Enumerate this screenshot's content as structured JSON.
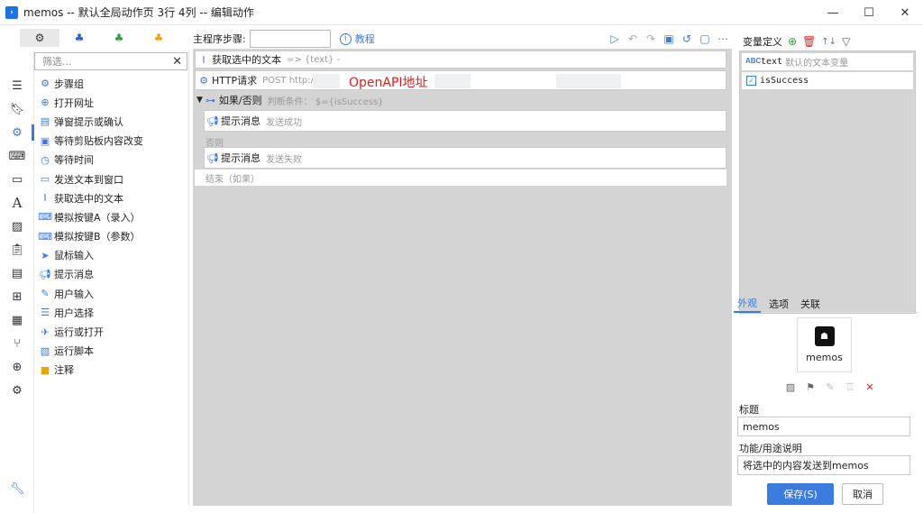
{
  "window": {
    "title": "memos -- 默认全局动作页 3行 4列 -- 编辑动作",
    "minimize": "—",
    "maximize": "☐",
    "close": "✕"
  },
  "left_tabs": [
    {
      "icon": "gears-icon"
    },
    {
      "icon": "cube-blue-icon"
    },
    {
      "icon": "cube-green-icon"
    },
    {
      "icon": "cube-orange-icon"
    }
  ],
  "filter": {
    "placeholder": "筛选...",
    "clear": "✕"
  },
  "actions": [
    {
      "label": "步骤组"
    },
    {
      "label": "打开网址"
    },
    {
      "label": "弹窗提示或确认"
    },
    {
      "label": "等待剪贴板内容改变"
    },
    {
      "label": "等待时间"
    },
    {
      "label": "发送文本到窗口"
    },
    {
      "label": "获取选中的文本"
    },
    {
      "label": "模拟按键A（录入）"
    },
    {
      "label": "模拟按键B（参数）"
    },
    {
      "label": "鼠标输入"
    },
    {
      "label": "提示消息"
    },
    {
      "label": "用户输入"
    },
    {
      "label": "用户选择"
    },
    {
      "label": "运行或打开"
    },
    {
      "label": "运行脚本"
    },
    {
      "label": "注释"
    }
  ],
  "topbar": {
    "step_label": "主程序步骤:",
    "help_label": "教程"
  },
  "steps": {
    "get_text": {
      "name": "获取选中的文本",
      "sub": "=> {text} -"
    },
    "http": {
      "name": "HTTP请求",
      "sub": "POST http://",
      "overlay": "OpenAPI地址"
    },
    "if": {
      "name": "如果/否则",
      "sub": "判断条件： $={isSuccess}"
    },
    "msg_ok": {
      "name": "提示消息",
      "sub": "发送成功"
    },
    "else": "否则",
    "msg_fail": {
      "name": "提示消息",
      "sub": "发送失败"
    },
    "end": "结束（如果）"
  },
  "vars": {
    "title": "变量定义",
    "items": [
      {
        "name": "text",
        "desc": "默认的文本变量",
        "type_icon": "ABC"
      },
      {
        "name": "isSuccess",
        "desc": "",
        "type_icon": "✓"
      }
    ]
  },
  "right_tabs": [
    "外观",
    "选项",
    "关联"
  ],
  "appearance": {
    "icon_name": "memos",
    "title_label": "标题",
    "title_value": "memos",
    "desc_label": "功能/用途说明",
    "desc_value": "将选中的内容发送到memos"
  },
  "buttons": {
    "save": "保存(S)",
    "cancel": "取消"
  },
  "colors": {
    "accent": "#3a7be0",
    "danger": "#e02020"
  }
}
